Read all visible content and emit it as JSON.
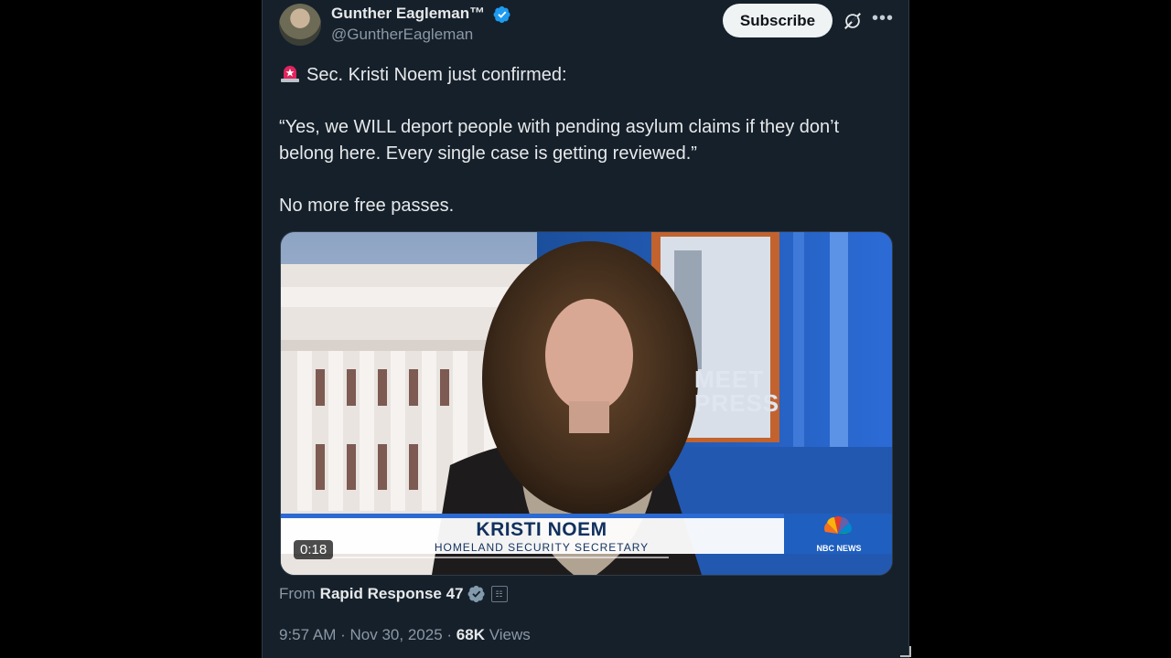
{
  "author": {
    "display_name": "Gunther Eagleman™",
    "handle": "@GuntherEagleman"
  },
  "actions": {
    "subscribe_label": "Subscribe",
    "grok_icon": "grok-icon",
    "more_icon": "more-icon"
  },
  "tweet": {
    "line1": "Sec. Kristi Noem just confirmed:",
    "quote": "“Yes, we WILL deport people with pending asylum claims if they don’t belong here. Every single case is getting reviewed.”",
    "closing": "No more free passes."
  },
  "video": {
    "duration": "0:18",
    "progress": 0.0,
    "lower_third_name": "KRISTI NOEM",
    "lower_third_title": "HOMELAND SECURITY SECRETARY",
    "network_logo_text": "NBC NEWS",
    "backdrop_text_line1": "MEET",
    "backdrop_text_line2": "PRESS"
  },
  "source": {
    "prefix": "From",
    "name": "Rapid Response 47"
  },
  "meta": {
    "time": "9:57 AM",
    "separator": "·",
    "date": "Nov 30, 2025",
    "views_count": "68K",
    "views_label": "Views"
  },
  "colors": {
    "background": "#15202b",
    "verified_blue": "#1d9bf0",
    "gray_check": "#829aab",
    "siren_red": "#e0245e"
  }
}
